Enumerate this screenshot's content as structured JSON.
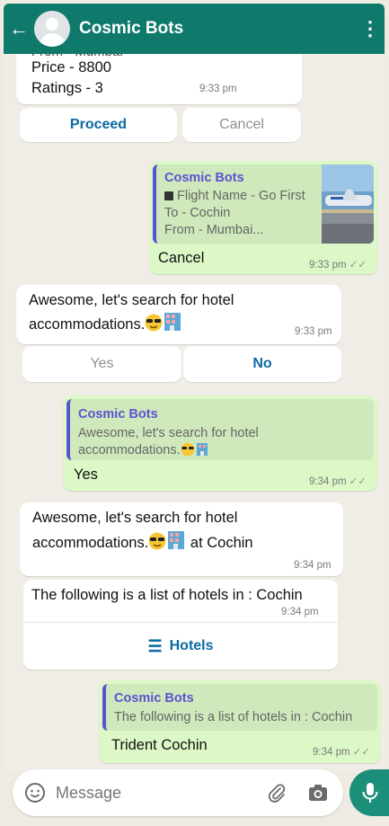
{
  "header": {
    "title": "Cosmic Bots"
  },
  "msg_top": {
    "partial_line": "From -  Mumbai",
    "price": "Price -  8800",
    "ratings": "Ratings -  3",
    "time": "9:33 pm",
    "buttons": [
      "Proceed",
      "Cancel"
    ]
  },
  "msg_cancel": {
    "quote_name": "Cosmic Bots",
    "quote_lines": [
      "Flight Name -  Go First",
      "To -  Cochin",
      "From -  Mumbai..."
    ],
    "text": "Cancel",
    "time": "9:33 pm"
  },
  "msg_hotel_search": {
    "line1": "Awesome, let's search for hotel",
    "line2": "accommodations.",
    "time": "9:33 pm",
    "buttons": [
      "Yes",
      "No"
    ]
  },
  "msg_yes": {
    "quote_name": "Cosmic Bots",
    "quote_lines": [
      "Awesome, let's search for hotel",
      "accommodations."
    ],
    "text": "Yes",
    "time": "9:34 pm"
  },
  "msg_cochin": {
    "line1": "Awesome, let's search for hotel",
    "line2": "accommodations.",
    "line2_suffix": " at Cochin",
    "time": "9:34 pm"
  },
  "msg_list": {
    "text": "The following is a list of hotels in : Cochin",
    "time": "9:34 pm",
    "button": "Hotels"
  },
  "msg_trident": {
    "quote_name": "Cosmic Bots",
    "quote_line": "The following is a list of hotels in : Cochin",
    "text": "Trident Cochin",
    "time": "9:34 pm"
  },
  "composer": {
    "placeholder": "Message"
  },
  "icons": {
    "back": "back-arrow-icon",
    "menu": "more-vertical-icon",
    "emoji": "emoji-icon",
    "attach": "paperclip-icon",
    "camera": "camera-icon",
    "mic": "microphone-icon",
    "read": "double-check-icon",
    "list": "list-icon"
  },
  "colors": {
    "header": "#0f7a6c",
    "outgoing": "#dcf8c6",
    "incoming": "#ffffff",
    "accent": "#0a6aa1",
    "quote_name": "#5c53d1",
    "mic": "#1c8f7a"
  }
}
